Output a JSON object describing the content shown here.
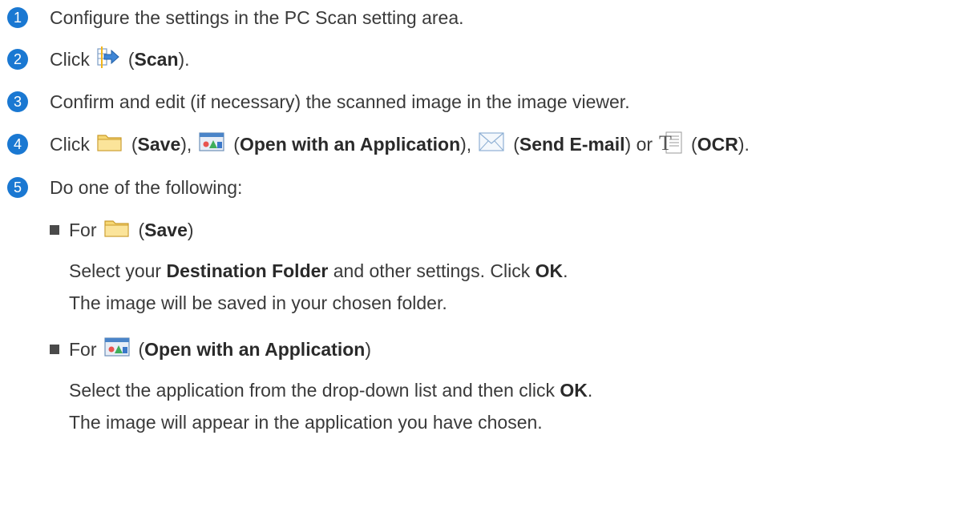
{
  "steps": [
    {
      "num": "1",
      "text": "Configure the settings in the PC Scan setting area."
    },
    {
      "num": "2",
      "pre": "Click",
      "open": "(",
      "bold": "Scan",
      "close": ")."
    },
    {
      "num": "3",
      "text": "Confirm and edit (if necessary) the scanned image in the image viewer."
    },
    {
      "num": "4",
      "pre": "Click",
      "save": "Save",
      "app": "Open with an Application",
      "mail": "Send E-mail",
      "or": "or",
      "ocr": "OCR"
    },
    {
      "num": "5",
      "text": "Do one of the following:"
    }
  ],
  "save_section": {
    "for": "For",
    "label": "Save",
    "line1_pre": "Select your",
    "line1_bold": "Destination Folder",
    "line1_mid": "and other settings. Click",
    "line1_ok": "OK",
    "line2": "The image will be saved in your chosen folder."
  },
  "app_section": {
    "for": "For",
    "label": "Open with an Application",
    "line1_pre": "Select the application from the drop-down list and then click",
    "line1_ok": "OK",
    "line2": "The image will appear in the application you have chosen."
  },
  "icons": [
    "scan-icon",
    "folder-icon",
    "open-application-icon",
    "email-envelope-icon",
    "ocr-document-icon"
  ],
  "colors": {
    "badge": "#1a78d2",
    "text": "#3a3a3a"
  }
}
